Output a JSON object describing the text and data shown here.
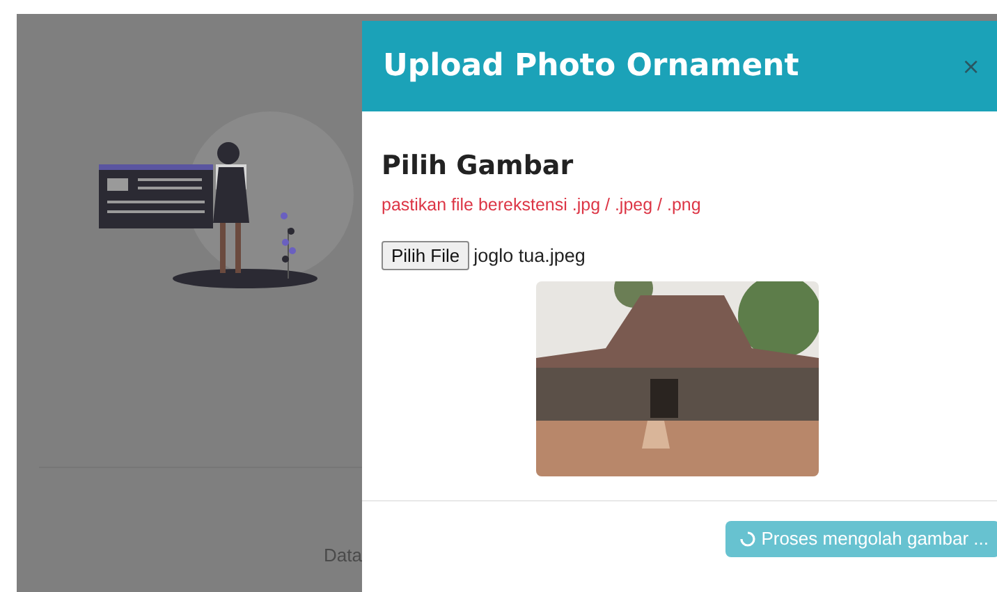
{
  "page": {
    "footer_text": "Data"
  },
  "modal": {
    "title": "Upload Photo Ornament",
    "close": "×",
    "heading": "Pilih Gambar",
    "hint": "pastikan file berekstensi .jpg / .jpeg / .png",
    "file_input": {
      "button": "Pilih File",
      "value": "joglo tua.jpeg"
    },
    "submit": {
      "label": "Proses mengolah gambar ...",
      "disabled": true,
      "loading": true
    }
  }
}
